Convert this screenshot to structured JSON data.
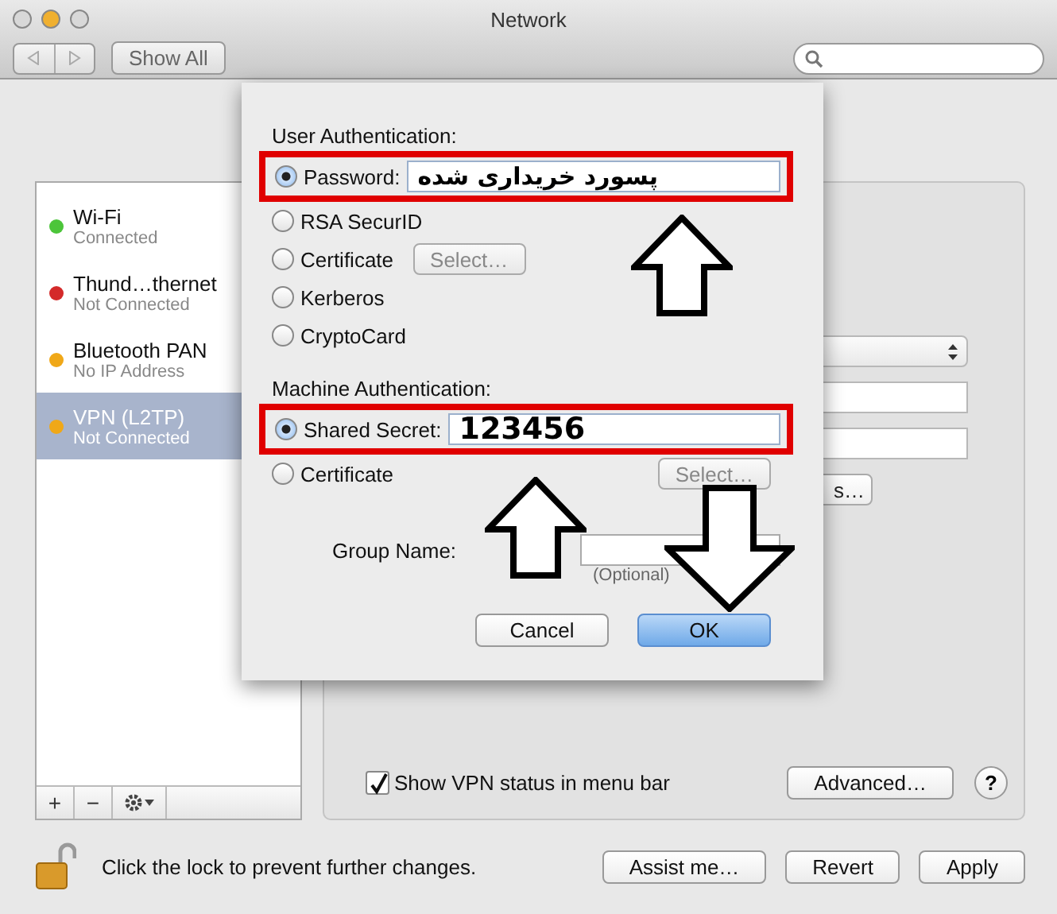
{
  "window": {
    "title": "Network"
  },
  "toolbar": {
    "show_all": "Show All"
  },
  "sidebar": {
    "items": [
      {
        "name": "Wi-Fi",
        "status": "Connected",
        "color": "#4cc53a",
        "selected": false
      },
      {
        "name": "Thund…thernet",
        "status": "Not Connected",
        "color": "#d42a2a",
        "selected": false
      },
      {
        "name": "Bluetooth PAN",
        "status": "No IP Address",
        "color": "#f0a818",
        "selected": false
      },
      {
        "name": "VPN (L2TP)",
        "status": "Not Connected",
        "color": "#f0a818",
        "selected": true
      }
    ],
    "add": "+",
    "remove": "−"
  },
  "detail": {
    "partial_button": "s…",
    "show_status": {
      "label": "Show VPN status in menu bar",
      "checked": true
    },
    "advanced": "Advanced…",
    "help": "?"
  },
  "sheet": {
    "user_auth": {
      "heading": "User Authentication:",
      "options": [
        {
          "kind": "field",
          "label": "Password:",
          "selected": true,
          "value": "پسورد خریداری شده",
          "highlighted": true
        },
        {
          "kind": "plain",
          "label": "RSA SecurID",
          "selected": false
        },
        {
          "kind": "button",
          "label": "Certificate",
          "selected": false,
          "button": "Select…"
        },
        {
          "kind": "plain",
          "label": "Kerberos",
          "selected": false
        },
        {
          "kind": "plain",
          "label": "CryptoCard",
          "selected": false
        }
      ]
    },
    "machine_auth": {
      "heading": "Machine Authentication:",
      "options": [
        {
          "kind": "field",
          "label": "Shared Secret:",
          "selected": true,
          "value": "123456",
          "highlighted": true
        },
        {
          "kind": "button",
          "label": "Certificate",
          "selected": false,
          "button": "Select…"
        }
      ]
    },
    "group_name": {
      "label": "Group Name:",
      "hint": "(Optional)"
    },
    "buttons": [
      {
        "label": "Cancel",
        "default": false
      },
      {
        "label": "OK",
        "default": true
      }
    ]
  },
  "annotations": [
    {
      "kind": "up"
    },
    {
      "kind": "up"
    },
    {
      "kind": "down"
    }
  ],
  "footer": {
    "lock_text": "Click the lock to prevent further changes.",
    "buttons": [
      "Assist me…",
      "Revert",
      "Apply"
    ]
  }
}
